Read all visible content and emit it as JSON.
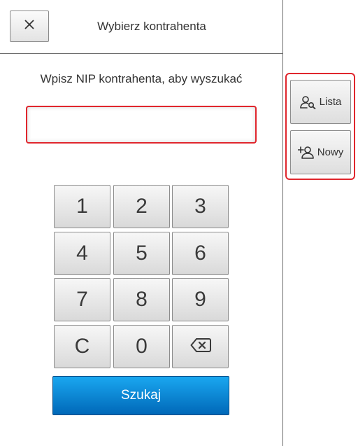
{
  "header": {
    "title": "Wybierz kontrahenta",
    "close_icon": "close-icon"
  },
  "prompt": "Wpisz NIP kontrahenta, aby wyszukać",
  "nip_input": {
    "value": "",
    "placeholder": ""
  },
  "keypad": {
    "keys": [
      {
        "label": "1"
      },
      {
        "label": "2"
      },
      {
        "label": "3"
      },
      {
        "label": "4"
      },
      {
        "label": "5"
      },
      {
        "label": "6"
      },
      {
        "label": "7"
      },
      {
        "label": "8"
      },
      {
        "label": "9"
      },
      {
        "label": "C"
      },
      {
        "label": "0"
      },
      {
        "label": "",
        "icon": "backspace-icon"
      }
    ]
  },
  "search_button": {
    "label": "Szukaj"
  },
  "sidebar": {
    "list_button": {
      "label": "Lista",
      "icon": "user-search-icon"
    },
    "new_button": {
      "label": "Nowy",
      "icon": "user-add-icon"
    }
  },
  "colors": {
    "accent_blue": "#0a86d6",
    "highlight_red": "#e0262d"
  }
}
